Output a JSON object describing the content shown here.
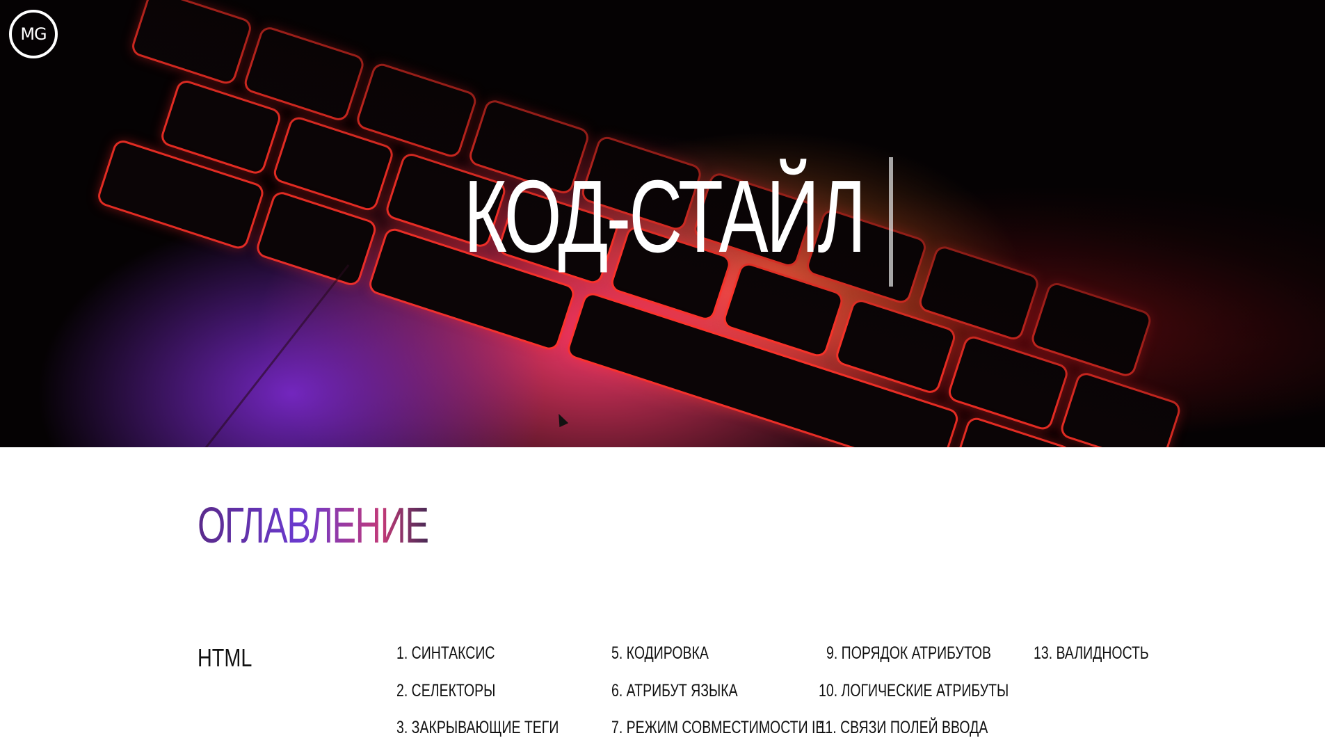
{
  "logo": {
    "text": "MG"
  },
  "hero": {
    "title": "КОД-СТАЙЛ"
  },
  "toc": {
    "title": "ОГЛАВЛЕНИЕ",
    "section": "HTML",
    "items": [
      "1. СИНТАКСИС",
      "2. СЕЛЕКТОРЫ",
      "3. ЗАКРЫВАЮЩИЕ ТЕГИ",
      "5. КОДИРОВКА",
      "6. АТРИБУТ ЯЗЫКА",
      "7. РЕЖИМ СОВМЕСТИМОСТИ IE",
      "9. ПОРЯДОК АТРИБУТОВ",
      "10. ЛОГИЧЕСКИЕ АТРИБУТЫ",
      "11. СВЯЗИ ПОЛЕЙ ВВОДА",
      "13. ВАЛИДНОСТЬ"
    ]
  },
  "colors": {
    "title_gradient": [
      "#5a2a8a",
      "#6a3ad0",
      "#c23a78"
    ],
    "hero_accent": "#ff3c28"
  }
}
